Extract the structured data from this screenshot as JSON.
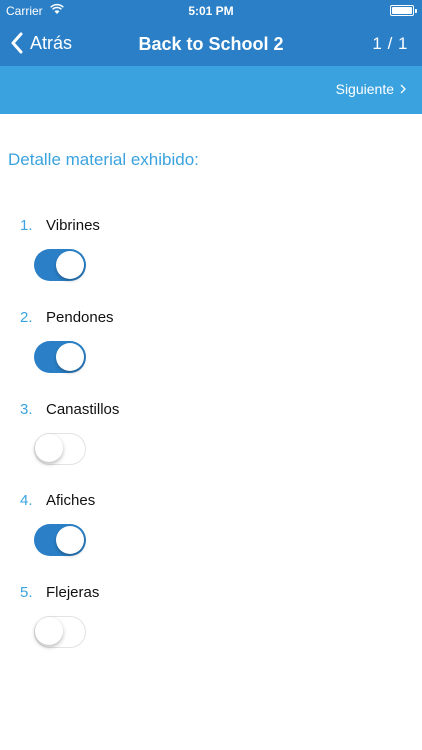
{
  "status_bar": {
    "carrier": "Carrier",
    "time": "5:01 PM"
  },
  "nav": {
    "back_label": "Atrás",
    "title": "Back to School 2",
    "pager": "1 / 1"
  },
  "subbar": {
    "next_label": "Siguiente"
  },
  "section": {
    "title": "Detalle material exhibido:"
  },
  "items": [
    {
      "number": "1.",
      "label": "Vibrines",
      "on": true
    },
    {
      "number": "2.",
      "label": "Pendones",
      "on": true
    },
    {
      "number": "3.",
      "label": "Canastillos",
      "on": false
    },
    {
      "number": "4.",
      "label": "Afiches",
      "on": true
    },
    {
      "number": "5.",
      "label": "Flejeras",
      "on": false
    }
  ],
  "colors": {
    "nav_bg": "#2a7fc6",
    "subbar_bg": "#3aa3df",
    "accent": "#3aa3df",
    "toggle_on": "#2a7fc6"
  }
}
